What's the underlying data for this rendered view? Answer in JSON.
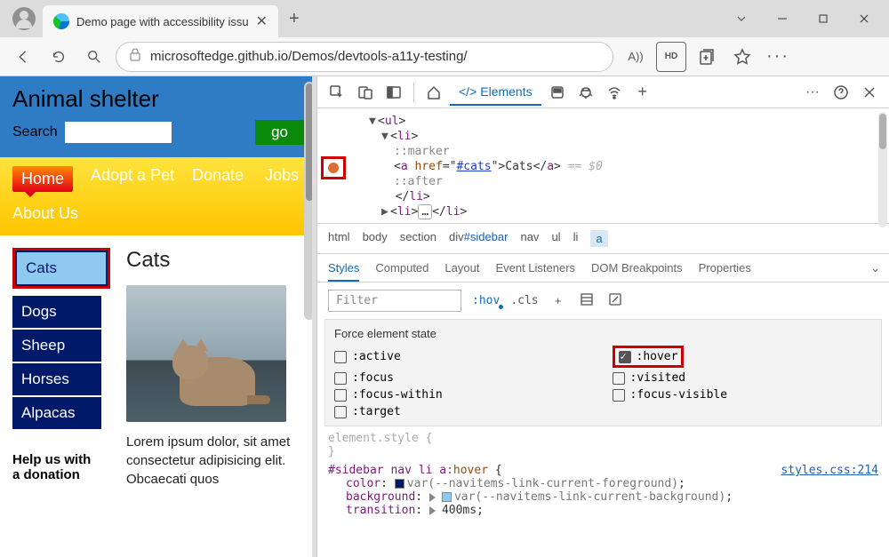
{
  "browser": {
    "tab_title": "Demo page with accessibility issu",
    "url": "microsoftedge.github.io/Demos/devtools-a11y-testing/",
    "reader_badge": "A))",
    "hd_badge": "HD"
  },
  "site": {
    "title": "Animal shelter",
    "search_label": "Search",
    "go_button": "go",
    "nav": {
      "home": "Home",
      "adopt": "Adopt a Pet",
      "donate": "Donate",
      "jobs": "Jobs",
      "about": "About Us"
    },
    "sidebar": [
      "Cats",
      "Dogs",
      "Sheep",
      "Horses",
      "Alpacas"
    ],
    "help_text": "Help us with a donation",
    "heading": "Cats",
    "lorem": "Lorem ipsum dolor, sit amet consectetur adipisicing elit. Obcaecati quos"
  },
  "devtools": {
    "elements_tab": "Elements",
    "code": {
      "ul": "ul",
      "li": "li",
      "marker": "::marker",
      "a_open": "a",
      "href_attr": "href",
      "href_val": "#cats",
      "cats_text": "Cats",
      "after": "::after",
      "eq0": "== $0",
      "dots": "…"
    },
    "crumbs": [
      "html",
      "body",
      "section",
      "div#sidebar",
      "nav",
      "ul",
      "li",
      "a"
    ],
    "styles_tabs": [
      "Styles",
      "Computed",
      "Layout",
      "Event Listeners",
      "DOM Breakpoints",
      "Properties"
    ],
    "filter_placeholder": "Filter",
    "hov_label": ":hov",
    "cls_label": ".cls",
    "force_title": "Force element state",
    "states": {
      "active": ":active",
      "focus": ":focus",
      "focus_within": ":focus-within",
      "target": ":target",
      "hover": ":hover",
      "visited": ":visited",
      "focus_visible": ":focus-visible"
    },
    "css": {
      "element_style": "element.style {",
      "close_brace": "}",
      "selector": "#sidebar nav li a:hover {",
      "link": "styles.css:214",
      "color_prop": "color",
      "color_val": "var(--navitems-link-current-foreground)",
      "bg_prop": "background",
      "bg_val": "var(--navitems-link-current-background)",
      "trans_prop": "transition",
      "trans_val": "400ms"
    }
  }
}
